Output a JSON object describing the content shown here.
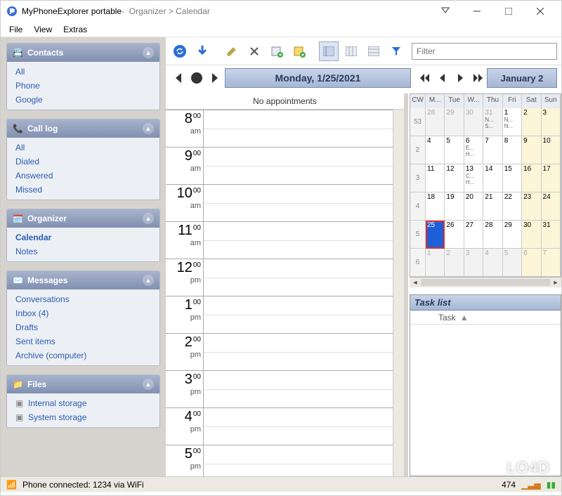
{
  "window": {
    "app": "MyPhoneExplorer portable",
    "breadcrumb_sep": " - ",
    "section": "Organizer",
    "sub": "Calendar"
  },
  "menu": {
    "file": "File",
    "view": "View",
    "extras": "Extras"
  },
  "sidebar": {
    "contacts": {
      "title": "Contacts",
      "items": [
        "All",
        "Phone",
        "Google"
      ]
    },
    "calllog": {
      "title": "Call log",
      "items": [
        "All",
        "Dialed",
        "Answered",
        "Missed"
      ]
    },
    "organizer": {
      "title": "Organizer",
      "items": [
        "Calendar",
        "Notes"
      ],
      "active": 0
    },
    "messages": {
      "title": "Messages",
      "items": [
        "Conversations",
        "Inbox (4)",
        "Drafts",
        "Sent items",
        "Archive (computer)"
      ]
    },
    "files": {
      "title": "Files",
      "items": [
        "Internal storage",
        "System storage"
      ]
    }
  },
  "toolbar": {
    "filter_placeholder": "Filter"
  },
  "daynav": {
    "date_label": "Monday, 1/25/2021",
    "no_appt": "No appointments",
    "hours": [
      {
        "h": "8",
        "m": "00",
        "ap": "am"
      },
      {
        "h": "9",
        "m": "00",
        "ap": "am"
      },
      {
        "h": "10",
        "m": "00",
        "ap": "am"
      },
      {
        "h": "11",
        "m": "00",
        "ap": "am"
      },
      {
        "h": "12",
        "m": "00",
        "ap": "pm"
      },
      {
        "h": "1",
        "m": "00",
        "ap": "pm"
      },
      {
        "h": "2",
        "m": "00",
        "ap": "pm"
      },
      {
        "h": "3",
        "m": "00",
        "ap": "pm"
      },
      {
        "h": "4",
        "m": "00",
        "ap": "pm"
      },
      {
        "h": "5",
        "m": "00",
        "ap": "pm"
      }
    ]
  },
  "monthnav": {
    "label": "January 2",
    "dow": [
      "CW",
      "M...",
      "Tue",
      "W...",
      "Thu",
      "Fri",
      "Sat",
      "Sun"
    ],
    "weeks": [
      {
        "wk": "53",
        "days": [
          {
            "d": "28",
            "dim": true
          },
          {
            "d": "29",
            "dim": true
          },
          {
            "d": "30",
            "dim": true
          },
          {
            "d": "31",
            "dim": true,
            "ev": [
              "N...",
              "S..."
            ]
          },
          {
            "d": "1",
            "ev": [
              "N...",
              "N..."
            ]
          },
          {
            "d": "2",
            "wkend": true
          },
          {
            "d": "3",
            "wkend": true
          }
        ]
      },
      {
        "wk": "2",
        "days": [
          {
            "d": "4"
          },
          {
            "d": "5"
          },
          {
            "d": "6",
            "ev": [
              "E...",
              "H..."
            ]
          },
          {
            "d": "7"
          },
          {
            "d": "8"
          },
          {
            "d": "9",
            "wkend": true
          },
          {
            "d": "10",
            "wkend": true
          }
        ]
      },
      {
        "wk": "3",
        "days": [
          {
            "d": "11"
          },
          {
            "d": "12"
          },
          {
            "d": "13",
            "ev": [
              "C...",
              "H..."
            ]
          },
          {
            "d": "14"
          },
          {
            "d": "15"
          },
          {
            "d": "16",
            "wkend": true
          },
          {
            "d": "17",
            "wkend": true
          }
        ]
      },
      {
        "wk": "4",
        "days": [
          {
            "d": "18"
          },
          {
            "d": "19"
          },
          {
            "d": "20"
          },
          {
            "d": "21"
          },
          {
            "d": "22"
          },
          {
            "d": "23",
            "wkend": true
          },
          {
            "d": "24",
            "wkend": true
          }
        ]
      },
      {
        "wk": "5",
        "days": [
          {
            "d": "25",
            "today": true
          },
          {
            "d": "26"
          },
          {
            "d": "27"
          },
          {
            "d": "28"
          },
          {
            "d": "29"
          },
          {
            "d": "30",
            "wkend": true
          },
          {
            "d": "31",
            "wkend": true
          }
        ]
      },
      {
        "wk": "6",
        "days": [
          {
            "d": "1",
            "dim": true
          },
          {
            "d": "2",
            "dim": true
          },
          {
            "d": "3",
            "dim": true
          },
          {
            "d": "4",
            "dim": true
          },
          {
            "d": "5",
            "dim": true
          },
          {
            "d": "6",
            "dim": true,
            "wkend": true
          },
          {
            "d": "7",
            "dim": true,
            "wkend": true
          }
        ]
      }
    ]
  },
  "tasks": {
    "title": "Task list",
    "col": "Task"
  },
  "status": {
    "text": "Phone connected: 1234 via WiFi",
    "count": "474"
  },
  "watermark": "LO4D"
}
